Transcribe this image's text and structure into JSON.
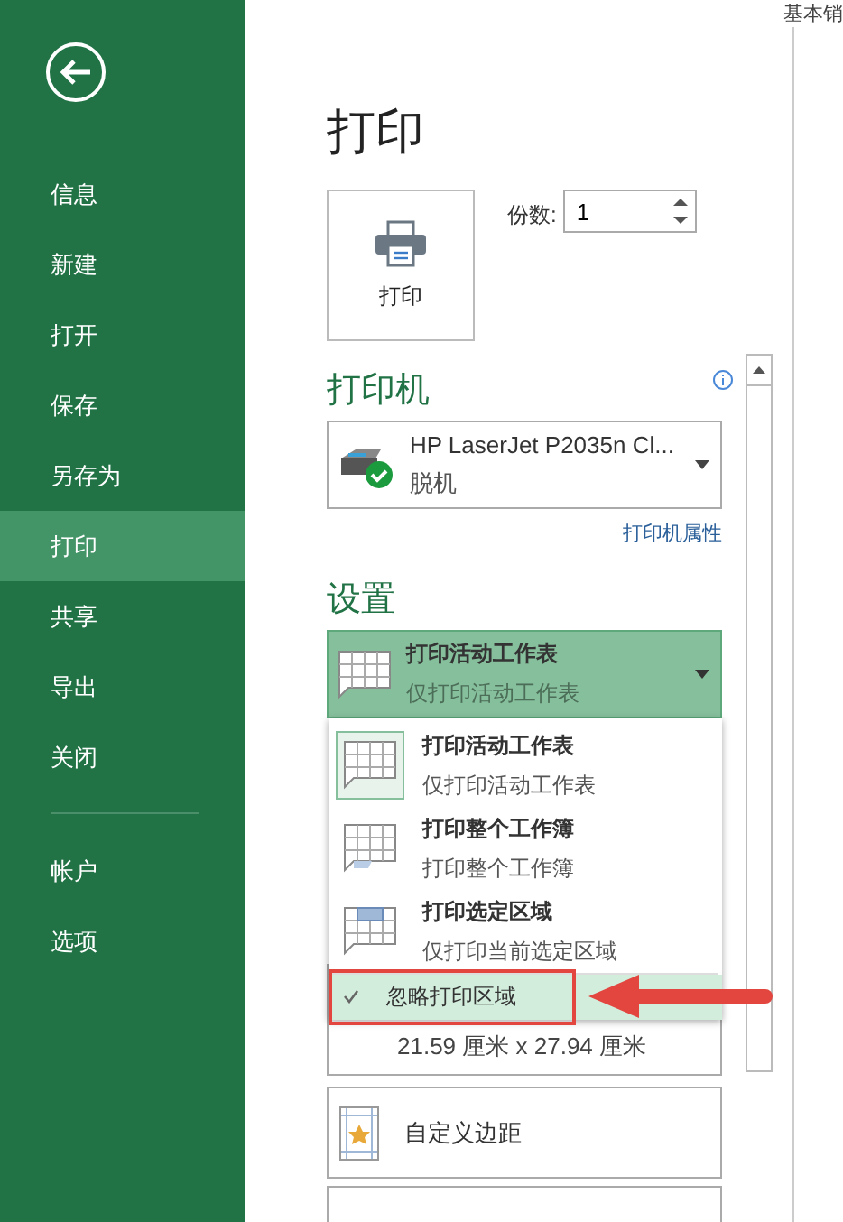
{
  "window": {
    "title": "基本销"
  },
  "nav": {
    "items": [
      {
        "label": "信息",
        "selected": false
      },
      {
        "label": "新建",
        "selected": false
      },
      {
        "label": "打开",
        "selected": false
      },
      {
        "label": "保存",
        "selected": false
      },
      {
        "label": "另存为",
        "selected": false
      },
      {
        "label": "打印",
        "selected": true
      },
      {
        "label": "共享",
        "selected": false
      },
      {
        "label": "导出",
        "selected": false
      },
      {
        "label": "关闭",
        "selected": false
      }
    ],
    "bottom_items": [
      {
        "label": "帐户",
        "selected": false
      },
      {
        "label": "选项",
        "selected": false
      }
    ]
  },
  "page_title": "打印",
  "print_button": "打印",
  "copies": {
    "label": "份数:",
    "value": "1"
  },
  "printer": {
    "heading": "打印机",
    "name": "HP LaserJet P2035n Cl...",
    "status": "脱机",
    "properties_link": "打印机属性"
  },
  "settings": {
    "heading": "设置",
    "current": {
      "title": "打印活动工作表",
      "subtitle": "仅打印活动工作表"
    },
    "options": [
      {
        "kind": "sheet",
        "title": "打印活动工作表",
        "subtitle": "仅打印活动工作表",
        "selected": true
      },
      {
        "kind": "workbook",
        "title": "打印整个工作簿",
        "subtitle": "打印整个工作簿",
        "selected": false
      },
      {
        "kind": "selection",
        "title": "打印选定区域",
        "subtitle": "仅打印当前选定区域",
        "selected": false
      }
    ],
    "ignore_print_area": {
      "label": "忽略打印区域",
      "checked": true
    },
    "paper_size": "21.59 厘米 x 27.94 厘米",
    "margins": "自定义边距"
  }
}
